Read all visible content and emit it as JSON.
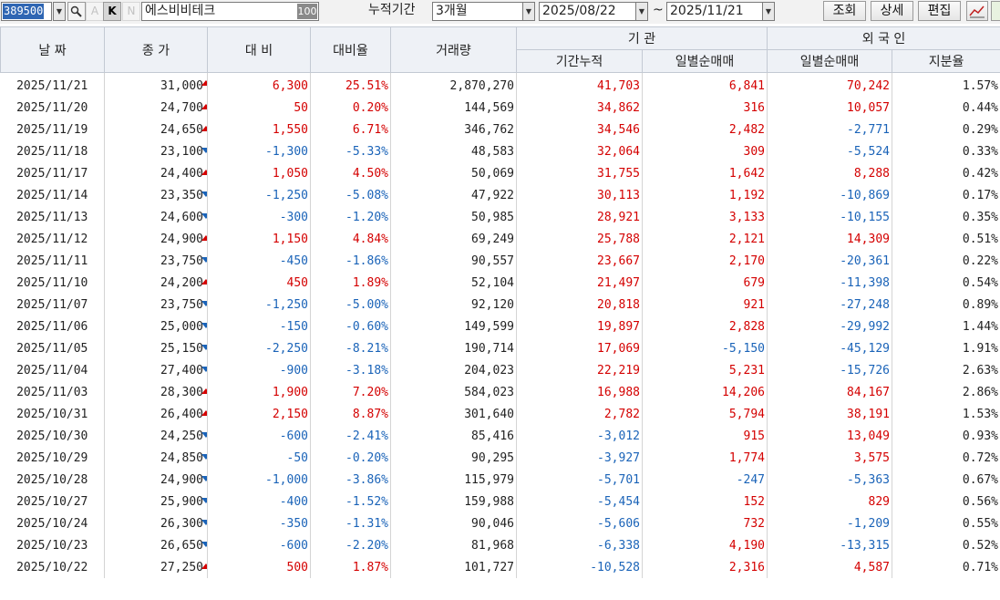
{
  "toolbar": {
    "code": "389500",
    "name": "에스비비테크",
    "badge": "100",
    "btn_a": "A",
    "btn_k": "K",
    "btn_n": "N",
    "period_label": "누적기간",
    "period_value": "3개월",
    "date_from": "2025/08/22",
    "tilde": "~",
    "date_to": "2025/11/21",
    "query_btn": "조회",
    "detail_btn": "상세",
    "edit_btn": "편집"
  },
  "headers": {
    "date": "날 짜",
    "close": "종 가",
    "change": "대 비",
    "rate": "대비율",
    "volume": "거래량",
    "inst": "기 관",
    "inst_cum": "기간누적",
    "inst_daily": "일별순매매",
    "foreign": "외 국 인",
    "foreign_daily": "일별순매매",
    "foreign_share": "지분율"
  },
  "colors": {
    "up": "#d40000",
    "down": "#1a63b8",
    "header_bg": "#eef1f6"
  },
  "rows": [
    {
      "date": "2025/11/21",
      "close": "31,000",
      "dir": "up",
      "change": "6,300",
      "rate": "25.51%",
      "volume": "2,870,270",
      "inst_cum": "41,703",
      "inst_daily": "6,841",
      "for_daily": "70,242",
      "share": "1.57%"
    },
    {
      "date": "2025/11/20",
      "close": "24,700",
      "dir": "up",
      "change": "50",
      "rate": "0.20%",
      "volume": "144,569",
      "inst_cum": "34,862",
      "inst_daily": "316",
      "for_daily": "10,057",
      "share": "0.44%"
    },
    {
      "date": "2025/11/19",
      "close": "24,650",
      "dir": "up",
      "change": "1,550",
      "rate": "6.71%",
      "volume": "346,762",
      "inst_cum": "34,546",
      "inst_daily": "2,482",
      "for_daily": "-2,771",
      "share": "0.29%"
    },
    {
      "date": "2025/11/18",
      "close": "23,100",
      "dir": "down",
      "change": "-1,300",
      "rate": "-5.33%",
      "volume": "48,583",
      "inst_cum": "32,064",
      "inst_daily": "309",
      "for_daily": "-5,524",
      "share": "0.33%"
    },
    {
      "date": "2025/11/17",
      "close": "24,400",
      "dir": "up",
      "change": "1,050",
      "rate": "4.50%",
      "volume": "50,069",
      "inst_cum": "31,755",
      "inst_daily": "1,642",
      "for_daily": "8,288",
      "share": "0.42%"
    },
    {
      "date": "2025/11/14",
      "close": "23,350",
      "dir": "down",
      "change": "-1,250",
      "rate": "-5.08%",
      "volume": "47,922",
      "inst_cum": "30,113",
      "inst_daily": "1,192",
      "for_daily": "-10,869",
      "share": "0.17%"
    },
    {
      "date": "2025/11/13",
      "close": "24,600",
      "dir": "down",
      "change": "-300",
      "rate": "-1.20%",
      "volume": "50,985",
      "inst_cum": "28,921",
      "inst_daily": "3,133",
      "for_daily": "-10,155",
      "share": "0.35%"
    },
    {
      "date": "2025/11/12",
      "close": "24,900",
      "dir": "up",
      "change": "1,150",
      "rate": "4.84%",
      "volume": "69,249",
      "inst_cum": "25,788",
      "inst_daily": "2,121",
      "for_daily": "14,309",
      "share": "0.51%"
    },
    {
      "date": "2025/11/11",
      "close": "23,750",
      "dir": "down",
      "change": "-450",
      "rate": "-1.86%",
      "volume": "90,557",
      "inst_cum": "23,667",
      "inst_daily": "2,170",
      "for_daily": "-20,361",
      "share": "0.22%"
    },
    {
      "date": "2025/11/10",
      "close": "24,200",
      "dir": "up",
      "change": "450",
      "rate": "1.89%",
      "volume": "52,104",
      "inst_cum": "21,497",
      "inst_daily": "679",
      "for_daily": "-11,398",
      "share": "0.54%"
    },
    {
      "date": "2025/11/07",
      "close": "23,750",
      "dir": "down",
      "change": "-1,250",
      "rate": "-5.00%",
      "volume": "92,120",
      "inst_cum": "20,818",
      "inst_daily": "921",
      "for_daily": "-27,248",
      "share": "0.89%"
    },
    {
      "date": "2025/11/06",
      "close": "25,000",
      "dir": "down",
      "change": "-150",
      "rate": "-0.60%",
      "volume": "149,599",
      "inst_cum": "19,897",
      "inst_daily": "2,828",
      "for_daily": "-29,992",
      "share": "1.44%"
    },
    {
      "date": "2025/11/05",
      "close": "25,150",
      "dir": "down",
      "change": "-2,250",
      "rate": "-8.21%",
      "volume": "190,714",
      "inst_cum": "17,069",
      "inst_daily": "-5,150",
      "for_daily": "-45,129",
      "share": "1.91%"
    },
    {
      "date": "2025/11/04",
      "close": "27,400",
      "dir": "down",
      "change": "-900",
      "rate": "-3.18%",
      "volume": "204,023",
      "inst_cum": "22,219",
      "inst_daily": "5,231",
      "for_daily": "-15,726",
      "share": "2.63%"
    },
    {
      "date": "2025/11/03",
      "close": "28,300",
      "dir": "up",
      "change": "1,900",
      "rate": "7.20%",
      "volume": "584,023",
      "inst_cum": "16,988",
      "inst_daily": "14,206",
      "for_daily": "84,167",
      "share": "2.86%"
    },
    {
      "date": "2025/10/31",
      "close": "26,400",
      "dir": "up",
      "change": "2,150",
      "rate": "8.87%",
      "volume": "301,640",
      "inst_cum": "2,782",
      "inst_daily": "5,794",
      "for_daily": "38,191",
      "share": "1.53%"
    },
    {
      "date": "2025/10/30",
      "close": "24,250",
      "dir": "down",
      "change": "-600",
      "rate": "-2.41%",
      "volume": "85,416",
      "inst_cum": "-3,012",
      "inst_daily": "915",
      "for_daily": "13,049",
      "share": "0.93%"
    },
    {
      "date": "2025/10/29",
      "close": "24,850",
      "dir": "down",
      "change": "-50",
      "rate": "-0.20%",
      "volume": "90,295",
      "inst_cum": "-3,927",
      "inst_daily": "1,774",
      "for_daily": "3,575",
      "share": "0.72%"
    },
    {
      "date": "2025/10/28",
      "close": "24,900",
      "dir": "down",
      "change": "-1,000",
      "rate": "-3.86%",
      "volume": "115,979",
      "inst_cum": "-5,701",
      "inst_daily": "-247",
      "for_daily": "-5,363",
      "share": "0.67%"
    },
    {
      "date": "2025/10/27",
      "close": "25,900",
      "dir": "down",
      "change": "-400",
      "rate": "-1.52%",
      "volume": "159,988",
      "inst_cum": "-5,454",
      "inst_daily": "152",
      "for_daily": "829",
      "share": "0.56%"
    },
    {
      "date": "2025/10/24",
      "close": "26,300",
      "dir": "down",
      "change": "-350",
      "rate": "-1.31%",
      "volume": "90,046",
      "inst_cum": "-5,606",
      "inst_daily": "732",
      "for_daily": "-1,209",
      "share": "0.55%"
    },
    {
      "date": "2025/10/23",
      "close": "26,650",
      "dir": "down",
      "change": "-600",
      "rate": "-2.20%",
      "volume": "81,968",
      "inst_cum": "-6,338",
      "inst_daily": "4,190",
      "for_daily": "-13,315",
      "share": "0.52%"
    },
    {
      "date": "2025/10/22",
      "close": "27,250",
      "dir": "up",
      "change": "500",
      "rate": "1.87%",
      "volume": "101,727",
      "inst_cum": "-10,528",
      "inst_daily": "2,316",
      "for_daily": "4,587",
      "share": "0.71%"
    }
  ]
}
